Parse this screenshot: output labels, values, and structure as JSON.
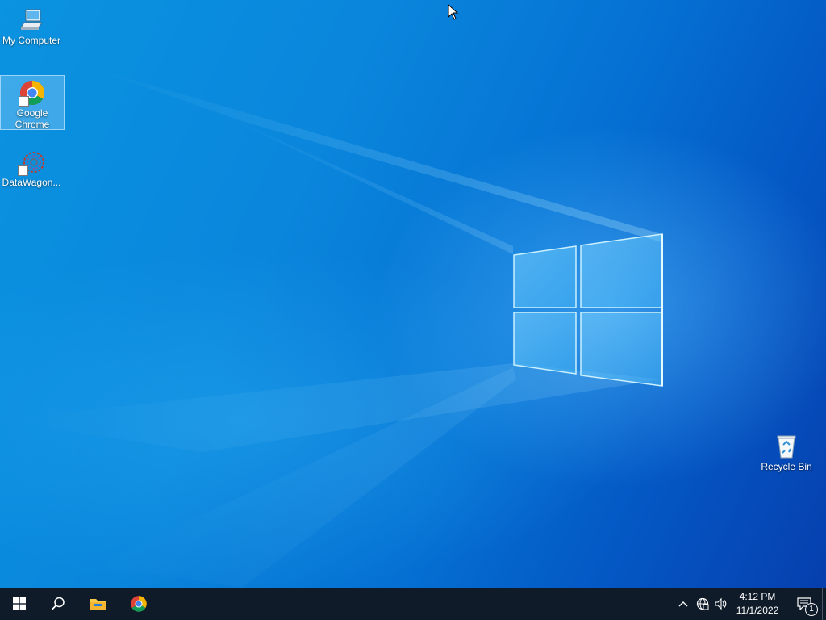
{
  "desktop": {
    "icons": [
      {
        "label": "My Computer",
        "icon": "computer-icon"
      },
      {
        "label": "Google\nChrome",
        "icon": "chrome-icon",
        "selected": true
      },
      {
        "label": "DataWagon...",
        "icon": "datawagon-icon"
      },
      {
        "label": "Recycle Bin",
        "icon": "recycle-bin-icon"
      }
    ]
  },
  "taskbar": {
    "buttons": [
      "start-icon",
      "search-icon",
      "file-explorer-icon",
      "chrome-icon"
    ],
    "tray": [
      "show-hidden-icons-chevron",
      "network-globe-icon",
      "volume-icon"
    ],
    "clock": {
      "time": "4:12 PM",
      "date": "11/1/2022"
    },
    "notifications": {
      "count": "1"
    }
  },
  "colors": {
    "taskbar": "#101b2a",
    "accent": "#0078d7"
  }
}
